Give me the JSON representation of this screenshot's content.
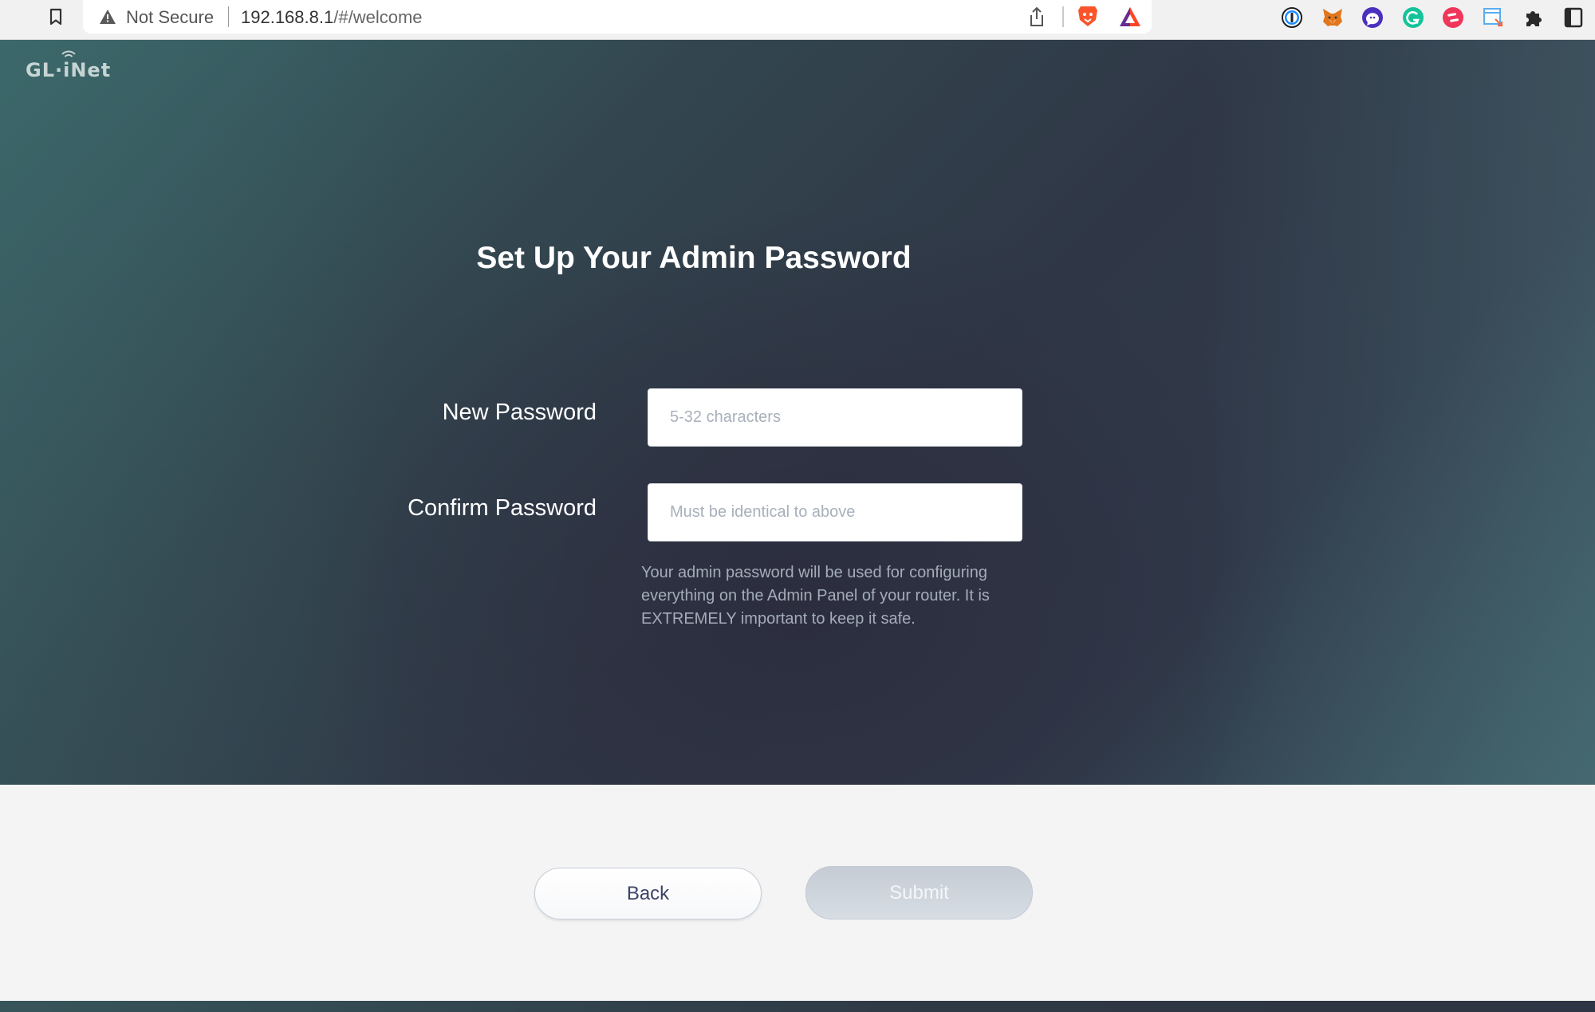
{
  "browser": {
    "security_label": "Not Secure",
    "url_host": "192.168.8.1",
    "url_path": "/#/welcome",
    "icons": {
      "bookmark": "bookmark-icon",
      "warning": "warning-triangle-icon",
      "share": "share-icon",
      "brave": "brave-shields-icon",
      "bat": "brave-rewards-icon"
    },
    "extensions": [
      {
        "name": "1password-icon",
        "color": "#1a8cff"
      },
      {
        "name": "metamask-icon",
        "color": "#e2761b"
      },
      {
        "name": "chat-bubble-icon",
        "color": "#4b2fbf"
      },
      {
        "name": "grammarly-icon",
        "color": "#15c39a"
      },
      {
        "name": "todoist-like-icon",
        "color": "#f0365b"
      },
      {
        "name": "window-resizer-icon",
        "color": "#5aaef0"
      },
      {
        "name": "extensions-puzzle-icon",
        "color": "#2a2a2a"
      },
      {
        "name": "sidebar-toggle-icon",
        "color": "#2a2a2a"
      }
    ]
  },
  "brand": {
    "logo_text": "GL·iNet"
  },
  "form": {
    "title": "Set Up Your Admin Password",
    "new_password": {
      "label": "New Password",
      "placeholder": "5-32 characters",
      "value": ""
    },
    "confirm_password": {
      "label": "Confirm Password",
      "placeholder": "Must be identical to above",
      "value": ""
    },
    "helper_text": "Your admin password will be used for configuring everything on the Admin Panel of your router. It is EXTREMELY important to keep it safe."
  },
  "actions": {
    "back_label": "Back",
    "submit_label": "Submit",
    "submit_disabled": true
  },
  "colors": {
    "hero_dark": "#2e3545",
    "hero_teal": "#3b6a6c",
    "actions_bg": "#f4f4f4",
    "submit_disabled_bg": "#ccd3db",
    "back_text": "#3f4366"
  }
}
